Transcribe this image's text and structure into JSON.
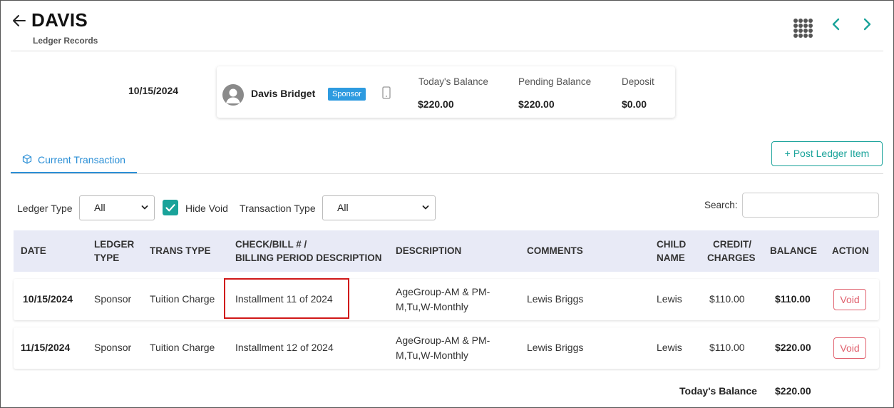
{
  "header": {
    "title": "DAVIS",
    "subtitle": "Ledger Records"
  },
  "summary": {
    "date": "10/15/2024",
    "person_name": "Davis Bridget",
    "badge": "Sponsor",
    "stats": [
      {
        "label": "Today's Balance",
        "value": "$220.00"
      },
      {
        "label": "Pending Balance",
        "value": "$220.00"
      },
      {
        "label": "Deposit",
        "value": "$0.00"
      }
    ]
  },
  "tabs": [
    {
      "label": "Current Transaction",
      "active": true
    }
  ],
  "post_button": "+ Post Ledger Item",
  "filters": {
    "ledger_type_label": "Ledger Type",
    "ledger_type_value": "All",
    "hide_void_label": "Hide Void",
    "hide_void_checked": true,
    "transaction_type_label": "Transaction Type",
    "transaction_type_value": "All",
    "search_label": "Search:",
    "search_value": ""
  },
  "table": {
    "headers": {
      "date": "DATE",
      "ledger_type_1": "LEDGER",
      "ledger_type_2": "TYPE",
      "trans_type": "TRANS TYPE",
      "check_1": "CHECK/BILL # /",
      "check_2": "BILLING PERIOD DESCRIPTION",
      "description": "DESCRIPTION",
      "comments": "COMMENTS",
      "child_1": "CHILD",
      "child_2": "NAME",
      "credit_1": "CREDIT/",
      "credit_2": "CHARGES",
      "balance": "BALANCE",
      "action": "ACTION"
    },
    "rows": [
      {
        "date": "10/15/2024",
        "ledger_type": "Sponsor",
        "trans_type": "Tuition Charge",
        "check_bill": "Installment 11 of 2024",
        "description_1": "AgeGroup-AM & PM-",
        "description_2": "M,Tu,W-Monthly",
        "comments": "Lewis Briggs",
        "child_name": "Lewis",
        "credit_charges": "$110.00",
        "balance": "$110.00",
        "action": "Void"
      },
      {
        "date": "11/15/2024",
        "ledger_type": "Sponsor",
        "trans_type": "Tuition Charge",
        "check_bill": "Installment 12 of 2024",
        "description_1": "AgeGroup-AM & PM-",
        "description_2": "M,Tu,W-Monthly",
        "comments": "Lewis Briggs",
        "child_name": "Lewis",
        "credit_charges": "$110.00",
        "balance": "$220.00",
        "action": "Void"
      }
    ],
    "footer_label": "Today's Balance",
    "footer_value": "$220.00"
  },
  "colors": {
    "accent_teal": "#1aa39a",
    "tab_blue": "#2b8fd6",
    "badge_blue": "#2e9be0",
    "void_red": "#e0606d",
    "highlight_red": "#d01818",
    "header_bg": "#e8eaf6"
  },
  "icons": [
    "back-arrow-icon",
    "apps-grid-icon",
    "chevron-left-icon",
    "chevron-right-icon",
    "user-avatar-icon",
    "mobile-phone-icon",
    "cube-icon",
    "check-icon",
    "chevron-down-icon"
  ]
}
